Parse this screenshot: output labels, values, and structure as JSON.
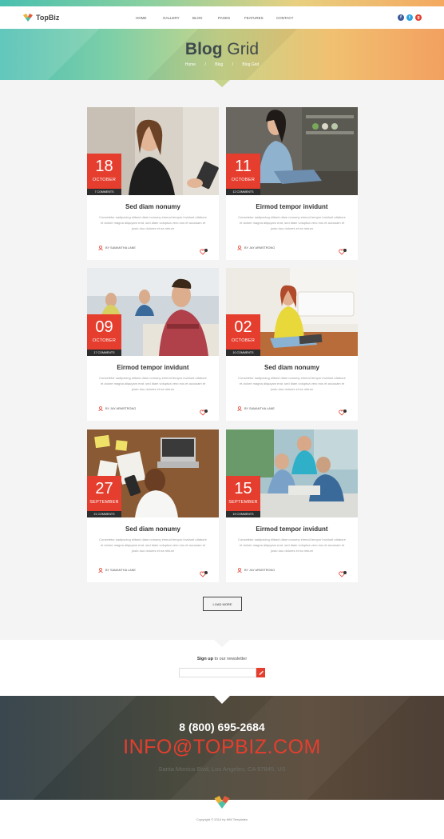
{
  "brand": {
    "name": "TopBiz"
  },
  "nav": [
    "HOME",
    "GALLERY",
    "BLOG",
    "PAGES",
    "FEATURES",
    "CONTACT"
  ],
  "social": [
    {
      "icon": "facebook-icon",
      "glyph": "f",
      "color": "#3b5998"
    },
    {
      "icon": "twitter-icon",
      "glyph": "t",
      "color": "#2aa3e0"
    },
    {
      "icon": "google-plus-icon",
      "glyph": "g",
      "color": "#e53e2e"
    }
  ],
  "hero": {
    "title_bold": "Blog",
    "title_rest": " Grid",
    "breadcrumb": [
      "Home",
      "/",
      "Blog",
      "/",
      "Blog Grid"
    ]
  },
  "posts": [
    {
      "day": "18",
      "month": "OCTOBER",
      "comments": "7 COMMENTS",
      "title": "Sed diam nonumy",
      "author": "BY SAMANTHA LANE",
      "likes": "3"
    },
    {
      "day": "11",
      "month": "OCTOBER",
      "comments": "12 COMMENTS",
      "title": "Eirmod tempor invidunt",
      "author": "BY JAY ARMSTRONG",
      "likes": "4"
    },
    {
      "day": "09",
      "month": "OCTOBER",
      "comments": "17 COMMENTS",
      "title": "Eirmod tempor invidunt",
      "author": "BY JAY ARMSTRONG",
      "likes": "8"
    },
    {
      "day": "02",
      "month": "OCTOBER",
      "comments": "10 COMMENTS",
      "title": "Sed diam nonumy",
      "author": "BY SAMANTHA LANE",
      "likes": "2"
    },
    {
      "day": "27",
      "month": "SEPTEMBER",
      "comments": "21 COMMENTS",
      "title": "Sed diam nonumy",
      "author": "BY SAMANTHA LANE",
      "likes": "6"
    },
    {
      "day": "15",
      "month": "SEPTEMBER",
      "comments": "19 COMMENTS",
      "title": "Eirmod tempor invidunt",
      "author": "BY JAY ARMSTRONG",
      "likes": "5"
    }
  ],
  "post_excerpt": "Consetetur sadipscing elitsed diam nonumy eirmod tempor invidunt utlabore et dolore magna aliquyam erat, sed diam voluptua vero eos et accusam et justo duo dolores et ea rebum",
  "load_more": "LOAD MORE",
  "newsletter": {
    "bold": "Sign up",
    "rest": " to our newsletter"
  },
  "footer": {
    "phone": "8 (800) 695-2684",
    "email": "INFO@TOPBIZ.COM",
    "address": "Santa Monica Blvd, Los Angeles, CA 97845, US",
    "copyright": "Copyright © 2014 by MW Templates"
  },
  "colors": {
    "accent": "#e53e2e",
    "dark": "#2d2d2d"
  }
}
